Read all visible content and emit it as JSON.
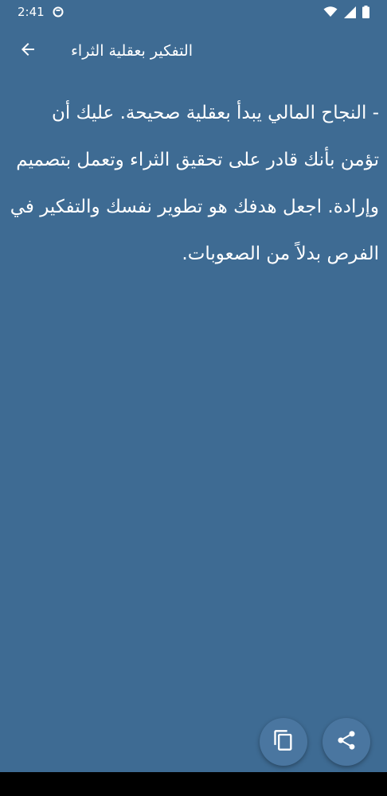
{
  "status_bar": {
    "time": "2:41",
    "icons": [
      "notification-icon",
      "wifi-icon",
      "signal-icon",
      "battery-icon"
    ]
  },
  "app_bar": {
    "title": "التفكير بعقلية الثراء",
    "back_icon": "arrow-back-icon"
  },
  "quote": {
    "text": "- النجاح المالي يبدأ بعقلية صحيحة. عليك أن تؤمن بأنك قادر على تحقيق الثراء وتعمل بتصميم وإرادة. اجعل هدفك هو تطوير نفسك والتفكير في الفرص بدلاً من الصعوبات."
  },
  "actions": {
    "copy_icon": "copy-icon",
    "share_icon": "share-icon"
  },
  "colors": {
    "background": "#3e6b93",
    "fab": "#4a76a0",
    "text": "#ffffff"
  }
}
